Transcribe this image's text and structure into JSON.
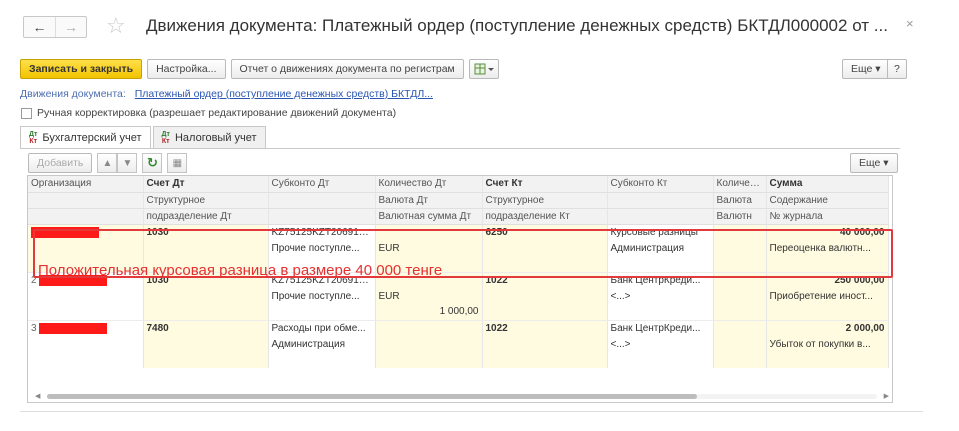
{
  "window": {
    "back_icon": "arrow-left",
    "forward_icon": "arrow-right",
    "title": "Движения документа: Платежный ордер (поступление денежных средств) БКТДЛ000002 от ...",
    "close": "×"
  },
  "toolbar": {
    "save_close": "Записать и закрыть",
    "settings": "Настройка...",
    "report": "Отчет о движениях документа по регистрам",
    "more": "Еще",
    "help": "?"
  },
  "doc_link": {
    "label": "Движения документа:",
    "link": "Платежный ордер (поступление денежных средств) БКТДЛ..."
  },
  "manual_edit": {
    "label": "Ручная корректировка (разрешает редактирование движений документа)",
    "checked": false
  },
  "tabs": [
    {
      "label": "Бухгалтерский учет",
      "active": true
    },
    {
      "label": "Налоговый учет",
      "active": false
    }
  ],
  "table_toolbar": {
    "add": "Добавить",
    "more": "Еще"
  },
  "columns": {
    "row1": [
      "Организация",
      "Счет Дт",
      "Субконто Дт",
      "Количество Дт",
      "Счет Кт",
      "Субконто Кт",
      "Количес...",
      "Сумма"
    ],
    "row2": [
      "",
      "Структурное",
      "",
      "Валюта Дт",
      "Структурное",
      "",
      "Валюта",
      "Содержание"
    ],
    "row3": [
      "",
      "подразделение Дт",
      "",
      "Валютная сумма Дт",
      "подразделение Кт",
      "",
      "Валютн",
      "№ журнала"
    ]
  },
  "rows": [
    {
      "num": "1",
      "account_dt": "1030",
      "subconto_dt": [
        "KZ75125KZT206910...",
        "Прочие поступле..."
      ],
      "currency_dt": "EUR",
      "currency_amount_dt": "",
      "account_kt": "6250",
      "subconto_kt": [
        "Курсовые разницы",
        "Администрация"
      ],
      "sum": "40 000,00",
      "content": "Переоценка валютн..."
    },
    {
      "num": "2",
      "account_dt": "1030",
      "subconto_dt": [
        "KZ75125KZT206910...",
        "Прочие поступле..."
      ],
      "currency_dt": "EUR",
      "currency_amount_dt": "1 000,00",
      "account_kt": "1022",
      "subconto_kt": [
        "Банк ЦентрКреди...",
        "<...>"
      ],
      "sum": "250 000,00",
      "content": "Приобретение иност..."
    },
    {
      "num": "3",
      "account_dt": "7480",
      "subconto_dt": [
        "Расходы при обме...",
        "Администрация"
      ],
      "currency_dt": "",
      "currency_amount_dt": "",
      "account_kt": "1022",
      "subconto_kt": [
        "Банк ЦентрКреди...",
        "<...>"
      ],
      "sum": "2 000,00",
      "content": "Убыток от покупки в..."
    }
  ],
  "annotation": "Положительная курсовая разница в размере 40 000 тенге",
  "colors": {
    "primary_button": "#f1c300",
    "highlight": "#e23a3a",
    "redaction": "#ff1a1a",
    "row_tint": "#fffbe0",
    "link": "#2a56b3"
  }
}
